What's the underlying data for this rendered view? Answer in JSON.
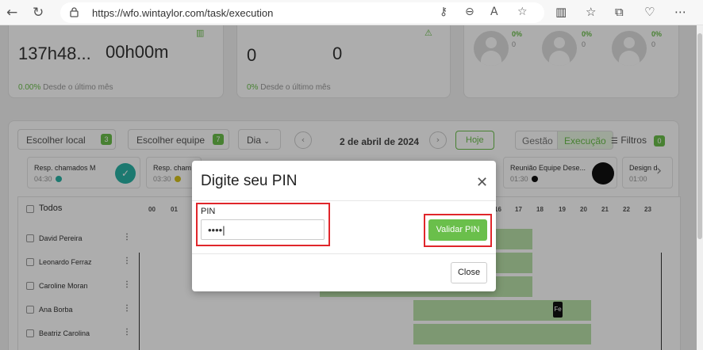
{
  "browser": {
    "url": "https://wfo.wintaylor.com/task/execution",
    "icons": [
      "back-icon",
      "reload-icon",
      "lock-icon",
      "key-icon",
      "zoom-icon",
      "read-aloud-icon",
      "favorite-icon",
      "split-screen-icon",
      "favorites-bar-icon",
      "collections-icon",
      "heart-icon",
      "more-icon"
    ]
  },
  "stats": {
    "card1": {
      "value1": "137h48...",
      "value2": "00h00m",
      "pct": "0.00%",
      "pct_text": "Desde o último mês"
    },
    "card2": {
      "value1": "0",
      "value2": "0",
      "pct": "0%",
      "pct_text": "Desde o último mês"
    },
    "avatars": [
      {
        "pct": "0%",
        "zero": "0"
      },
      {
        "pct": "0%",
        "zero": "0"
      },
      {
        "pct": "0%",
        "zero": "0"
      }
    ]
  },
  "toolbar": {
    "local_label": "Escolher local",
    "local_count": "3",
    "team_label": "Escolher equipe",
    "team_count": "7",
    "period": "Dia",
    "date": "2 de abril de 2024",
    "today": "Hoje",
    "gestao": "Gestão",
    "execucao": "Execução",
    "filters": "Filtros",
    "filters_count": "0"
  },
  "tasks": [
    {
      "title": "Resp. chamados M",
      "time": "04:30"
    },
    {
      "title": "Resp. cham",
      "time": "03:30"
    },
    {
      "title": "Reunião Equipe Dese...",
      "time": "01:30"
    },
    {
      "title": "Design d",
      "time": "01:00"
    }
  ],
  "grid": {
    "all_label": "Todos",
    "hours": [
      "00",
      "01",
      "16",
      "17",
      "18",
      "19",
      "20",
      "21",
      "22",
      "23"
    ],
    "rows": [
      "David Pereira",
      "Leonardo Ferraz",
      "Caroline Moran",
      "Ana Borba",
      "Beatriz Carolina"
    ],
    "marker": "Fe"
  },
  "modal": {
    "title": "Digite seu PIN",
    "pin_label": "PIN",
    "pin_value": "••••|",
    "validate_label": "Validar PIN",
    "close_label": "Close",
    "highlight_color": "#e0262b",
    "accent_color": "#6abf4b"
  }
}
